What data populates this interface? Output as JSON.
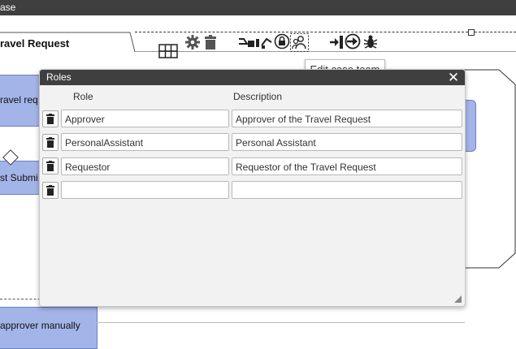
{
  "app": {
    "title": "ase"
  },
  "canvas": {
    "tab_label": "ravel Request",
    "tooltip": "Edit case team",
    "toolbar_icons": [
      "grid-icon",
      "gear-icon",
      "trash-icon",
      "hierarchy-icon",
      "lock-icon",
      "case-team-icon",
      "import-icon",
      "deploy-icon",
      "debug-icon"
    ]
  },
  "background": {
    "travel_label": "ravel req",
    "submit_label": "st Submi",
    "approver_label": "approver manually"
  },
  "dialog": {
    "title": "Roles",
    "close_label": "✕",
    "columns": {
      "role": "Role",
      "description": "Description"
    },
    "rows": [
      {
        "role": "Approver",
        "description": "Approver of the Travel Request"
      },
      {
        "role": "PersonalAssistant",
        "description": "Personal Assistant"
      },
      {
        "role": "Requestor",
        "description": "Requestor of the Travel Request"
      },
      {
        "role": "",
        "description": ""
      }
    ]
  },
  "colors": {
    "titlebar": "#3f3f3f",
    "shape_fill": "#a3b5e8",
    "dialog_bg": "#f2f2f2"
  }
}
